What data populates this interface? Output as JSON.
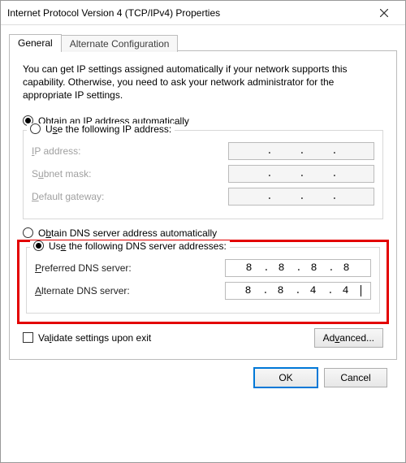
{
  "window": {
    "title": "Internet Protocol Version 4 (TCP/IPv4) Properties"
  },
  "tabs": {
    "general": "General",
    "alternate": "Alternate Configuration"
  },
  "intro": "You can get IP settings assigned automatically if your network supports this capability. Otherwise, you need to ask your network administrator for the appropriate IP settings.",
  "ip_section": {
    "auto_label_pre": "O",
    "auto_label_rest": "btain an IP address automatically",
    "manual_label_pre": "U",
    "manual_label_u": "s",
    "manual_label_rest": "e the following IP address:",
    "ip_address_pre": "I",
    "ip_address_rest": "P address:",
    "subnet_pre": "S",
    "subnet_u": "u",
    "subnet_rest": "bnet mask:",
    "gateway_pre": "D",
    "gateway_rest": "efault gateway:",
    "ip_selected": "auto",
    "values": {
      "ip": [
        "",
        "",
        "",
        ""
      ],
      "mask": [
        "",
        "",
        "",
        ""
      ],
      "gateway": [
        "",
        "",
        "",
        ""
      ]
    }
  },
  "dns_section": {
    "auto_label_pre": "O",
    "auto_label_u": "b",
    "auto_label_rest": "tain DNS server address automatically",
    "manual_label_pre": "Us",
    "manual_label_u": "e",
    "manual_label_rest": " the following DNS server addresses:",
    "preferred_pre": "P",
    "preferred_rest": "referred DNS server:",
    "alternate_pre": "A",
    "alternate_rest": "lternate DNS server:",
    "dns_selected": "manual",
    "preferred": [
      "8",
      "8",
      "8",
      "8"
    ],
    "alternate": [
      "8",
      "8",
      "4",
      "4"
    ]
  },
  "validate_label_pre": "Va",
  "validate_label_u": "l",
  "validate_label_rest": "idate settings upon exit",
  "validate_checked": false,
  "advanced_btn_pre": "Ad",
  "advanced_btn_u": "v",
  "advanced_btn_rest": "anced...",
  "ok_btn": "OK",
  "cancel_btn": "Cancel"
}
